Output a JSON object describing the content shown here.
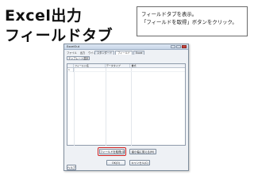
{
  "slide": {
    "title_line1": "Excel出力",
    "title_line2": "フィールドタブ"
  },
  "callout": {
    "line1": "フィールドタブを表示。",
    "line2": "「フィールドを取得」ボタンをクリック。"
  },
  "window": {
    "title": "ExcelOut",
    "menu": [
      "ファイル",
      "出力",
      "ウインドウ",
      "ヘルプ"
    ],
    "tabs": [
      "スタンダード",
      "フィールド",
      "Excel"
    ],
    "toolbar": [
      "テンプレート選択"
    ],
    "grid": {
      "headers": [
        "フィールド名",
        "データタイプ",
        "書式"
      ],
      "rows": [
        "1"
      ]
    },
    "buttons": {
      "get_fields": "フィールドを取得(G)",
      "minimal_width": "最小幅に揃える(M)",
      "ok": "OK(O)",
      "cancel": "キャンセル(C)",
      "help": "ヘルプ"
    }
  }
}
